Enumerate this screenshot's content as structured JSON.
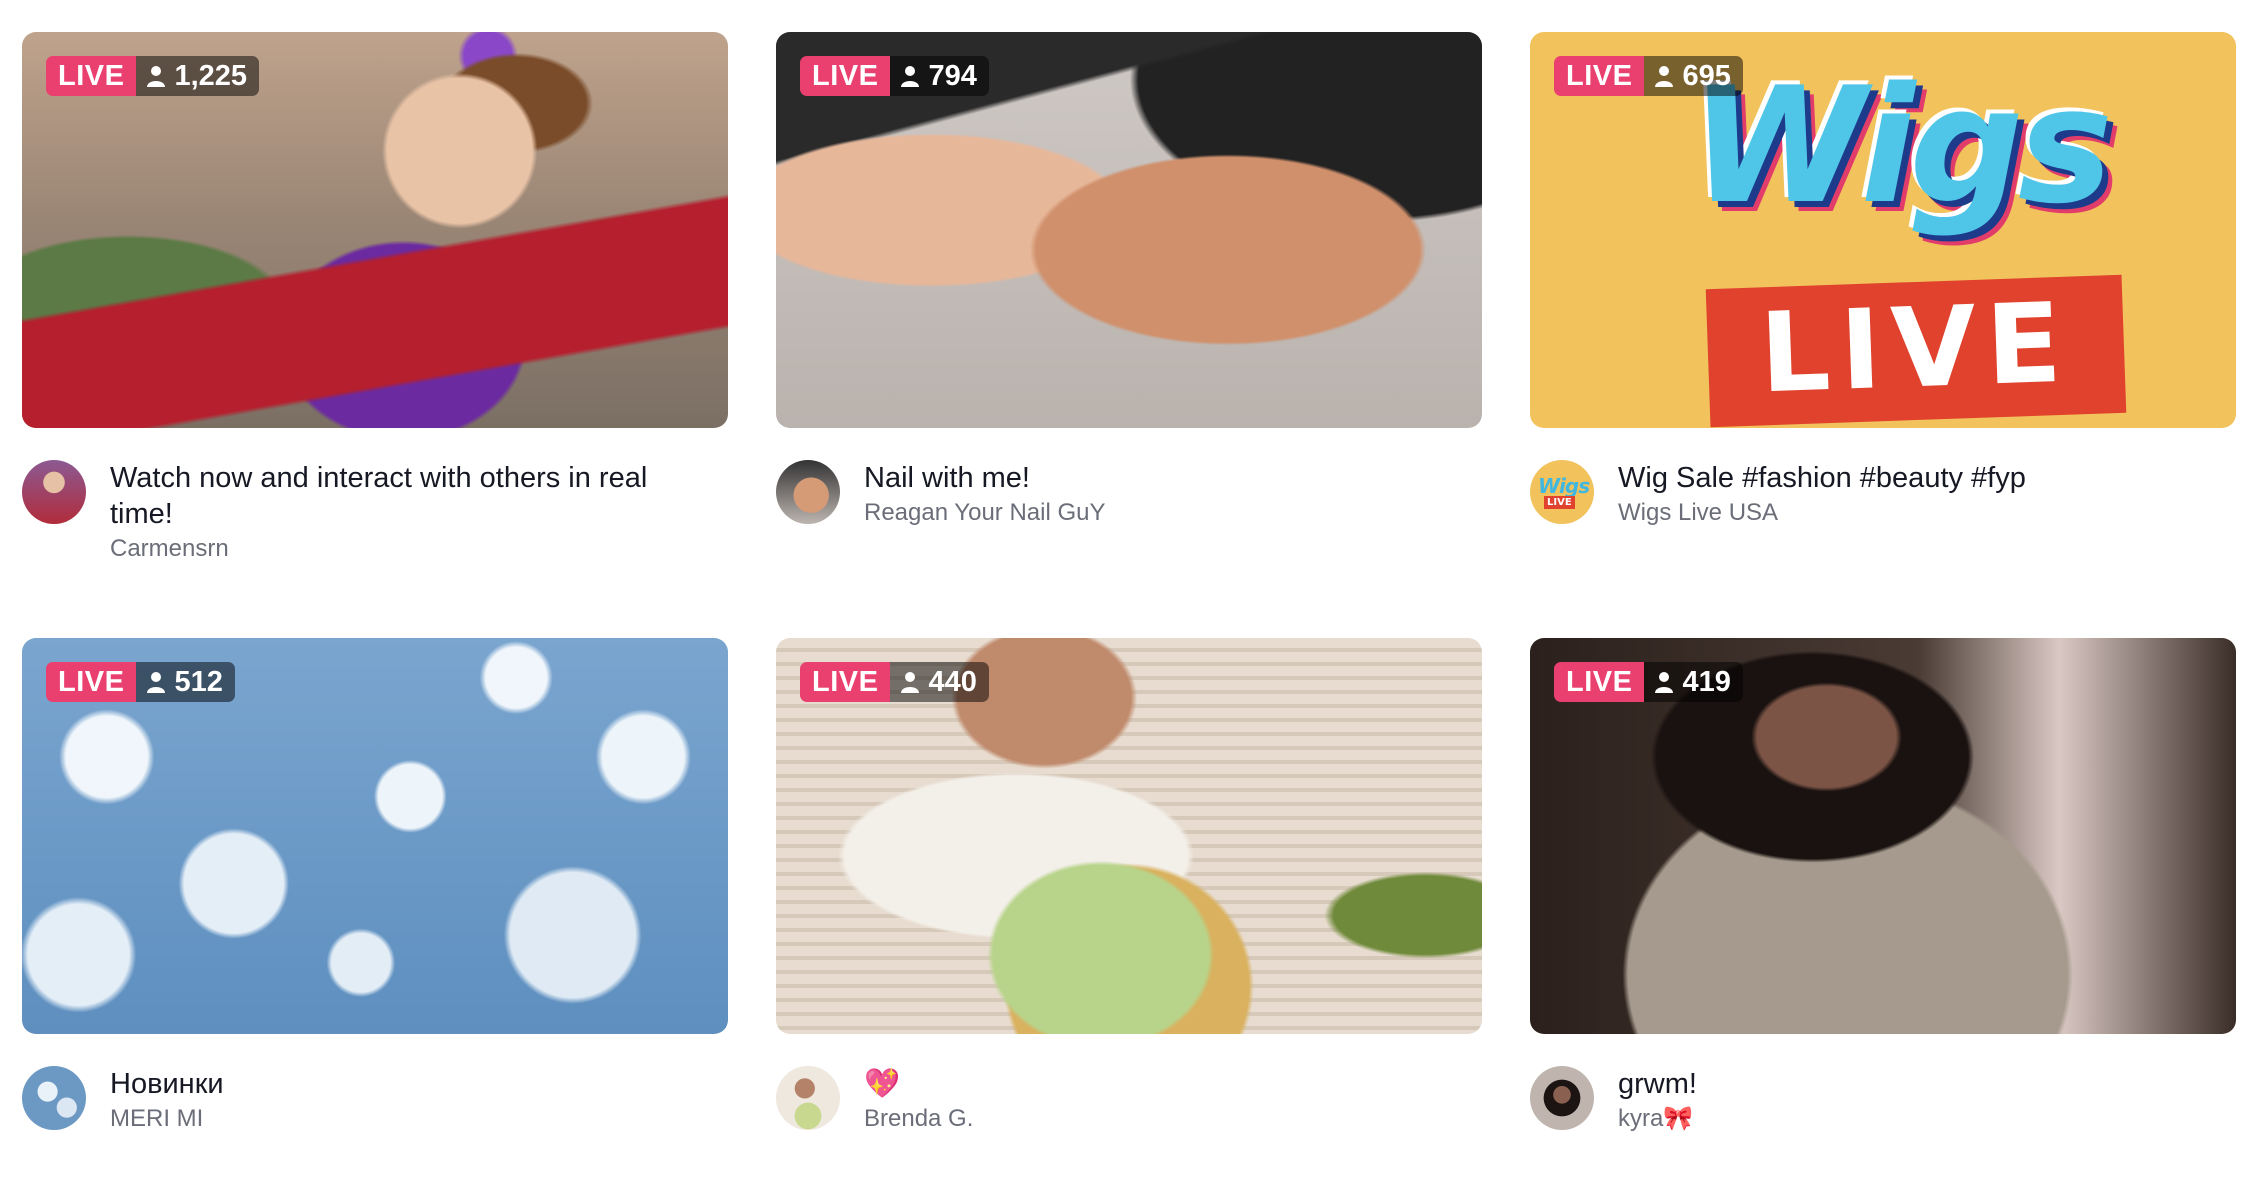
{
  "streams": [
    {
      "badge": "LIVE",
      "viewers": "1,225",
      "title": "Watch now and interact with others in real time!",
      "author": "Carmensrn"
    },
    {
      "badge": "LIVE",
      "viewers": "794",
      "title": "Nail with me!",
      "author": "Reagan Your Nail GuY"
    },
    {
      "badge": "LIVE",
      "viewers": "695",
      "title": "Wig Sale #fashion #beauty #fyp",
      "author": "Wigs Live USA",
      "thumb_text": {
        "word": "Wigs",
        "live": "LIVE"
      }
    },
    {
      "badge": "LIVE",
      "viewers": "512",
      "title": "Новинки",
      "author": "MERI MI"
    },
    {
      "badge": "LIVE",
      "viewers": "440",
      "title": "💖",
      "author": "Brenda G."
    },
    {
      "badge": "LIVE",
      "viewers": "419",
      "title": "grwm!",
      "author": "kyra🎀"
    }
  ],
  "colors": {
    "live_badge": "#ea4070",
    "title_text": "#161823",
    "author_text": "#6b6e78"
  },
  "icons": {
    "viewer_count": "person-icon"
  }
}
